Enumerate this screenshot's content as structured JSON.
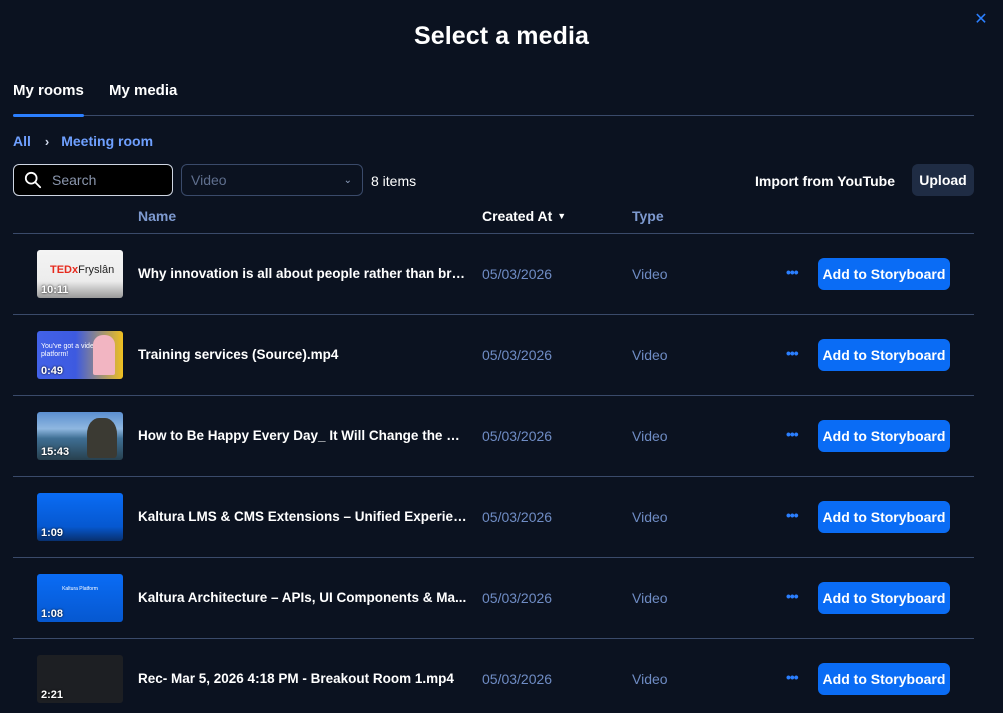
{
  "modal": {
    "title": "Select a media",
    "close_icon": "close-icon"
  },
  "tabs": [
    {
      "label": "My rooms",
      "active": true
    },
    {
      "label": "My media",
      "active": false
    }
  ],
  "breadcrumb": {
    "root": "All",
    "current": "Meeting room"
  },
  "toolbar": {
    "search_placeholder": "Search",
    "type_filter": "Video",
    "items_count": "8 items",
    "import_label": "Import from YouTube",
    "upload_label": "Upload"
  },
  "table": {
    "headers": {
      "name": "Name",
      "created_at": "Created At",
      "type": "Type"
    },
    "rows": [
      {
        "name": "Why innovation is all about people rather than brig...",
        "duration": "10:11",
        "date": "05/03/2026",
        "type": "Video",
        "action": "Add to Storyboard"
      },
      {
        "name": "Training services (Source).mp4",
        "duration": "0:49",
        "date": "05/03/2026",
        "type": "Video",
        "action": "Add to Storyboard"
      },
      {
        "name": "How to Be Happy Every Day_ It Will Change the W...",
        "duration": "15:43",
        "date": "05/03/2026",
        "type": "Video",
        "action": "Add to Storyboard"
      },
      {
        "name": "Kaltura LMS & CMS Extensions – Unified Experien...",
        "duration": "1:09",
        "date": "05/03/2026",
        "type": "Video",
        "action": "Add to Storyboard"
      },
      {
        "name": "Kaltura Architecture – APIs, UI Components & Ma...",
        "duration": "1:08",
        "date": "05/03/2026",
        "type": "Video",
        "action": "Add to Storyboard"
      },
      {
        "name": "Rec- Mar 5, 2026 4:18 PM - Breakout Room 1.mp4",
        "duration": "2:21",
        "date": "05/03/2026",
        "type": "Video",
        "action": "Add to Storyboard"
      }
    ]
  },
  "thumbnails": {
    "t0_text": "TEDx",
    "t0_sub": "Fryslân",
    "t1_text": "You've got a video platform!",
    "t4_text": "Kaltura Platform"
  },
  "colors": {
    "background": "#0b1220",
    "accent": "#0a6cf5",
    "link": "#6fa0ff"
  }
}
